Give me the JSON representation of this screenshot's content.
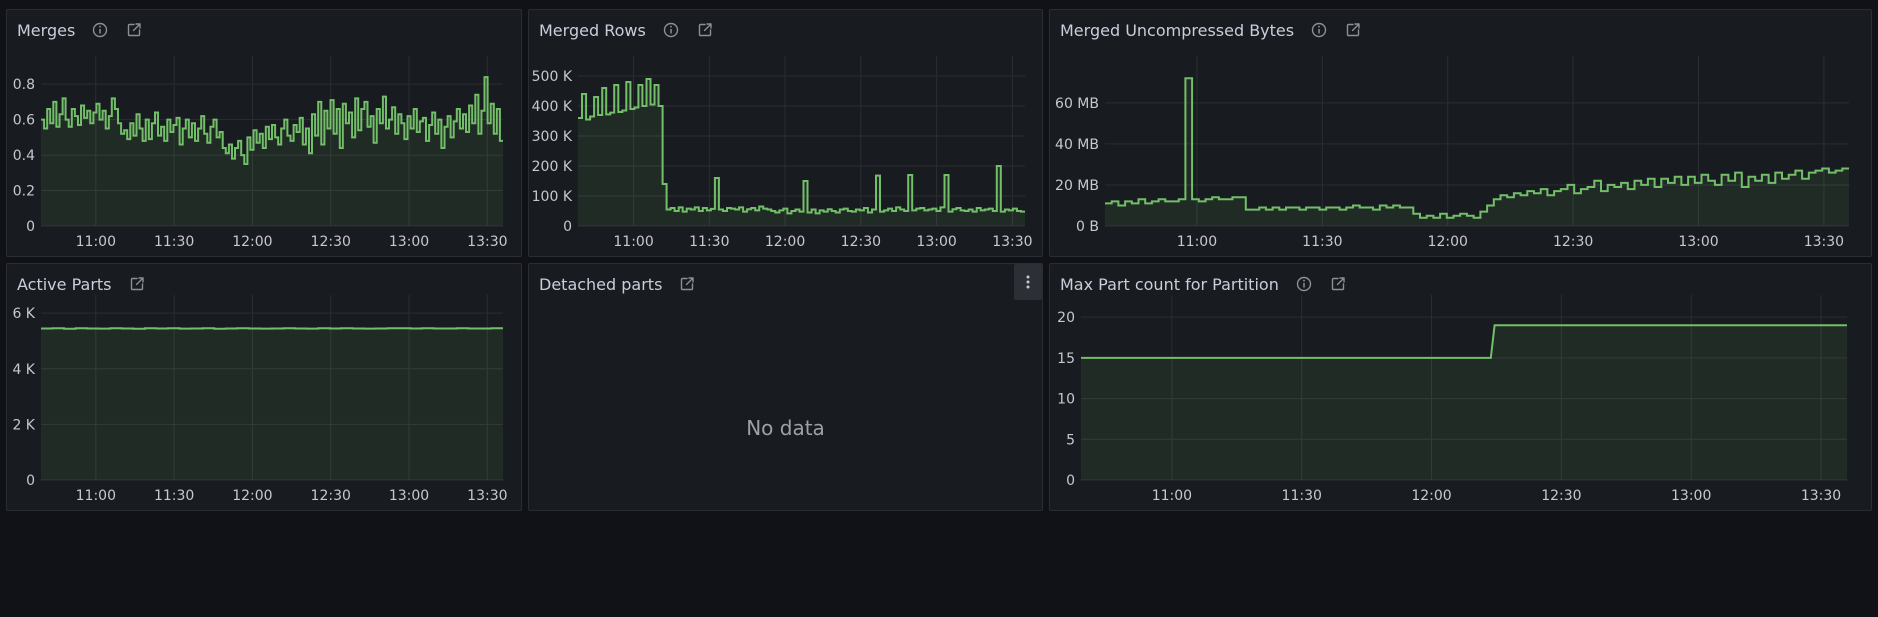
{
  "colors": {
    "series": "#73bf69",
    "fill": "rgba(115,191,105,0.10)",
    "grid": "#2b2e34"
  },
  "panels": [
    {
      "id": "merges",
      "title": "Merges",
      "icons": [
        "info-icon",
        "external-link-icon"
      ],
      "chart_data": {
        "type": "line",
        "title": "Merges",
        "xlabel": "",
        "ylabel": "",
        "x_ticks": [
          "11:00",
          "11:30",
          "12:00",
          "12:30",
          "13:00",
          "13:30"
        ],
        "y_ticks": [
          "0",
          "0.2",
          "0.4",
          "0.6",
          "0.8"
        ],
        "ylim": [
          0,
          0.88
        ],
        "xlim": [
          "10:39",
          "13:36"
        ],
        "series": [
          {
            "values": [
              0.6,
              0.55,
              0.66,
              0.58,
              0.7,
              0.56,
              0.63,
              0.72,
              0.6,
              0.56,
              0.66,
              0.62,
              0.57,
              0.68,
              0.61,
              0.65,
              0.58,
              0.64,
              0.69,
              0.6,
              0.65,
              0.55,
              0.62,
              0.72,
              0.66,
              0.58,
              0.52,
              0.54,
              0.49,
              0.58,
              0.51,
              0.63,
              0.55,
              0.48,
              0.6,
              0.49,
              0.58,
              0.64,
              0.51,
              0.56,
              0.48,
              0.6,
              0.53,
              0.57,
              0.61,
              0.46,
              0.55,
              0.6,
              0.5,
              0.58,
              0.48,
              0.55,
              0.62,
              0.52,
              0.47,
              0.56,
              0.6,
              0.5,
              0.53,
              0.44,
              0.41,
              0.46,
              0.38,
              0.44,
              0.48,
              0.4,
              0.35,
              0.5,
              0.43,
              0.54,
              0.47,
              0.52,
              0.44,
              0.56,
              0.49,
              0.57,
              0.5,
              0.46,
              0.55,
              0.6,
              0.51,
              0.48,
              0.57,
              0.53,
              0.61,
              0.46,
              0.55,
              0.41,
              0.63,
              0.51,
              0.7,
              0.46,
              0.65,
              0.55,
              0.71,
              0.52,
              0.66,
              0.44,
              0.69,
              0.58,
              0.64,
              0.5,
              0.72,
              0.54,
              0.66,
              0.7,
              0.56,
              0.62,
              0.47,
              0.66,
              0.58,
              0.73,
              0.55,
              0.6,
              0.67,
              0.52,
              0.63,
              0.58,
              0.49,
              0.62,
              0.55,
              0.66,
              0.53,
              0.59,
              0.61,
              0.48,
              0.57,
              0.64,
              0.52,
              0.6,
              0.44,
              0.56,
              0.62,
              0.5,
              0.59,
              0.66,
              0.55,
              0.63,
              0.53,
              0.68,
              0.58,
              0.74,
              0.52,
              0.65,
              0.84,
              0.58,
              0.69,
              0.52,
              0.66,
              0.48
            ]
          }
        ]
      }
    },
    {
      "id": "merged-rows",
      "title": "Merged Rows",
      "icons": [
        "info-icon",
        "external-link-icon"
      ],
      "chart_data": {
        "type": "line",
        "title": "Merged Rows",
        "xlabel": "",
        "ylabel": "",
        "x_ticks": [
          "11:00",
          "11:30",
          "12:00",
          "12:30",
          "13:00",
          "13:30"
        ],
        "y_ticks": [
          "0",
          "100 K",
          "200 K",
          "300 K",
          "400 K",
          "500 K"
        ],
        "ylim": [
          0,
          520000
        ],
        "xlim": [
          "10:38",
          "13:35"
        ],
        "series": [
          {
            "values": [
              360000,
              440000,
              355000,
              365000,
              430000,
              370000,
              460000,
              372000,
              378000,
              470000,
              380000,
              385000,
              480000,
              390000,
              395000,
              470000,
              400000,
              490000,
              405000,
              470000,
              400000,
              140000,
              55000,
              60000,
              50000,
              62000,
              48000,
              58000,
              55000,
              62000,
              50000,
              60000,
              52000,
              57000,
              160000,
              55000,
              50000,
              60000,
              58000,
              55000,
              62000,
              48000,
              56000,
              60000,
              52000,
              65000,
              58000,
              55000,
              50000,
              45000,
              52000,
              58000,
              42000,
              50000,
              55000,
              48000,
              150000,
              45000,
              55000,
              42000,
              52000,
              48000,
              56000,
              50000,
              45000,
              55000,
              58000,
              50000,
              48000,
              55000,
              52000,
              60000,
              45000,
              55000,
              168000,
              48000,
              52000,
              58000,
              50000,
              62000,
              55000,
              50000,
              170000,
              52000,
              58000,
              60000,
              52000,
              55000,
              58000,
              50000,
              62000,
              170000,
              48000,
              56000,
              60000,
              52000,
              50000,
              55000,
              48000,
              60000,
              52000,
              55000,
              58000,
              50000,
              200000,
              48000,
              55000,
              52000,
              58000,
              50000,
              48000
            ]
          }
        ]
      }
    },
    {
      "id": "merged-uncompressed-bytes",
      "title": "Merged Uncompressed Bytes",
      "icons": [
        "info-icon",
        "external-link-icon"
      ],
      "chart_data": {
        "type": "line",
        "title": "Merged Uncompressed Bytes",
        "xlabel": "",
        "ylabel": "",
        "x_ticks": [
          "11:00",
          "11:30",
          "12:00",
          "12:30",
          "13:00",
          "13:30"
        ],
        "y_ticks": [
          "0 B",
          "20 MB",
          "40 MB",
          "60 MB"
        ],
        "ylim": [
          0,
          76
        ],
        "xlim": [
          "10:38",
          "13:36"
        ],
        "series": [
          {
            "values": [
              11,
              12,
              10,
              12,
              11,
              13,
              11,
              12,
              13,
              12,
              12,
              13,
              72,
              13,
              12,
              13,
              14,
              13,
              13,
              14,
              14,
              8,
              8,
              9,
              8,
              9,
              8,
              9,
              9,
              8,
              9,
              9,
              8,
              9,
              9,
              8,
              9,
              10,
              9,
              9,
              8,
              10,
              9,
              10,
              9,
              9,
              6,
              4,
              5,
              4,
              6,
              4,
              5,
              6,
              5,
              4,
              7,
              10,
              13,
              15,
              14,
              16,
              15,
              17,
              16,
              18,
              15,
              17,
              18,
              20,
              16,
              18,
              19,
              22,
              17,
              20,
              19,
              21,
              18,
              22,
              20,
              23,
              19,
              23,
              21,
              24,
              20,
              24,
              21,
              25,
              22,
              20,
              25,
              22,
              26,
              19,
              24,
              22,
              25,
              21,
              26,
              23,
              25,
              27,
              23,
              26,
              27,
              28,
              26,
              27,
              28
            ]
          }
        ]
      }
    },
    {
      "id": "active-parts",
      "title": "Active Parts",
      "icons": [
        "external-link-icon"
      ],
      "chart_data": {
        "type": "line",
        "title": "Active Parts",
        "xlabel": "",
        "ylabel": "",
        "x_ticks": [
          "11:00",
          "11:30",
          "12:00",
          "12:30",
          "13:00",
          "13:30"
        ],
        "y_ticks": [
          "0",
          "2 K",
          "4 K",
          "6 K"
        ],
        "ylim": [
          0,
          6150
        ],
        "xlim": [
          "10:39",
          "13:36"
        ],
        "series": [
          {
            "values": [
              5450,
              5460,
              5440,
              5455,
              5450,
              5445,
              5460,
              5450,
              5440,
              5455,
              5450,
              5460,
              5445,
              5450,
              5455,
              5440,
              5450,
              5460,
              5450,
              5445,
              5450,
              5455,
              5450,
              5445,
              5460,
              5450,
              5455,
              5450,
              5445,
              5450,
              5455,
              5460,
              5450,
              5455,
              5450,
              5450,
              5455,
              5450,
              5450,
              5455
            ]
          }
        ]
      }
    },
    {
      "id": "detached-parts",
      "title": "Detached parts",
      "icons": [
        "external-link-icon"
      ],
      "has_menu": true,
      "menu_icon": "kebab-menu-icon",
      "no_data_text": "No data"
    },
    {
      "id": "max-part-count",
      "title": "Max Part count for Partition",
      "icons": [
        "info-icon",
        "external-link-icon"
      ],
      "chart_data": {
        "type": "line",
        "title": "Max Part count for Partition",
        "xlabel": "",
        "ylabel": "",
        "x_ticks": [
          "11:00",
          "11:30",
          "12:00",
          "12:30",
          "13:00",
          "13:30"
        ],
        "y_ticks": [
          "0",
          "5",
          "10",
          "15",
          "20"
        ],
        "ylim": [
          0,
          21
        ],
        "xlim": [
          "10:39",
          "13:36"
        ],
        "series": [
          {
            "steps": [
              [
                0,
                15
              ],
              [
                0.535,
                15
              ],
              [
                0.54,
                19
              ],
              [
                1,
                19
              ]
            ]
          }
        ]
      }
    }
  ]
}
